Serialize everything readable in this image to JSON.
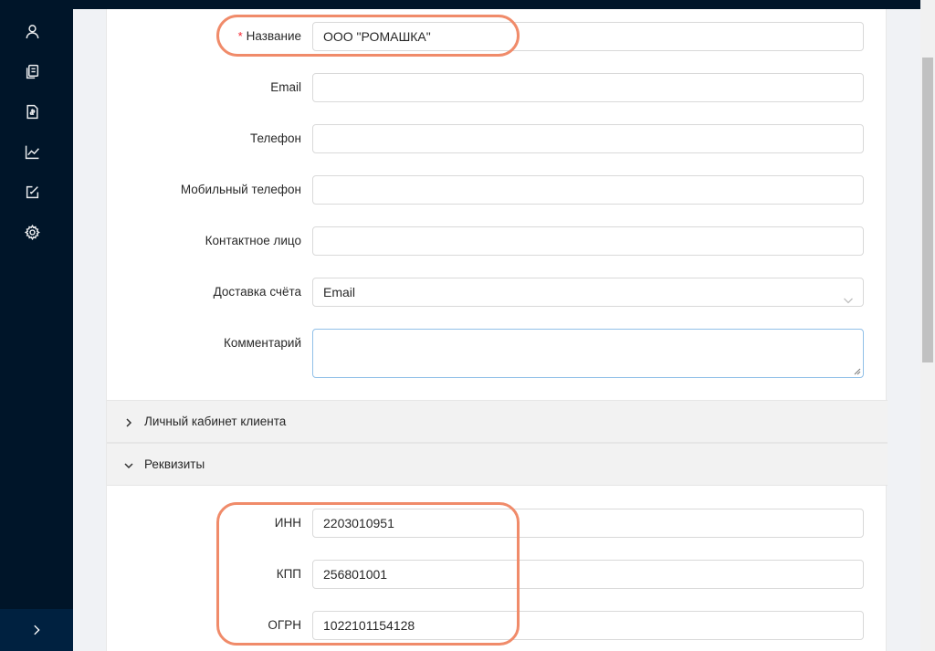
{
  "sidebar": {
    "icons": [
      "user-icon",
      "documents-icon",
      "invoice-icon",
      "chart-icon",
      "edit-icon",
      "settings-icon"
    ],
    "collapse_icon": "chevron-right-icon"
  },
  "form": {
    "name": {
      "label": "Название",
      "required_mark": "*",
      "value": "ООО \"РОМАШКА\""
    },
    "email": {
      "label": "Email",
      "value": ""
    },
    "phone": {
      "label": "Телефон",
      "value": ""
    },
    "mobile": {
      "label": "Мобильный телефон",
      "value": ""
    },
    "contact": {
      "label": "Контактное лицо",
      "value": ""
    },
    "delivery": {
      "label": "Доставка счёта",
      "value": "Email"
    },
    "comment": {
      "label": "Комментарий",
      "value": ""
    }
  },
  "panels": {
    "cabinet": {
      "title": "Личный кабинет клиента",
      "expanded": false
    },
    "requisites": {
      "title": "Реквизиты",
      "expanded": true
    }
  },
  "requisites": {
    "inn": {
      "label": "ИНН",
      "value": "2203010951"
    },
    "kpp": {
      "label": "КПП",
      "value": "256801001"
    },
    "ogrn": {
      "label": "ОГРН",
      "value": "1022101154128"
    }
  },
  "colors": {
    "sidebar_bg": "#001529",
    "highlight": "#f08b6a",
    "required": "#f5222d"
  }
}
